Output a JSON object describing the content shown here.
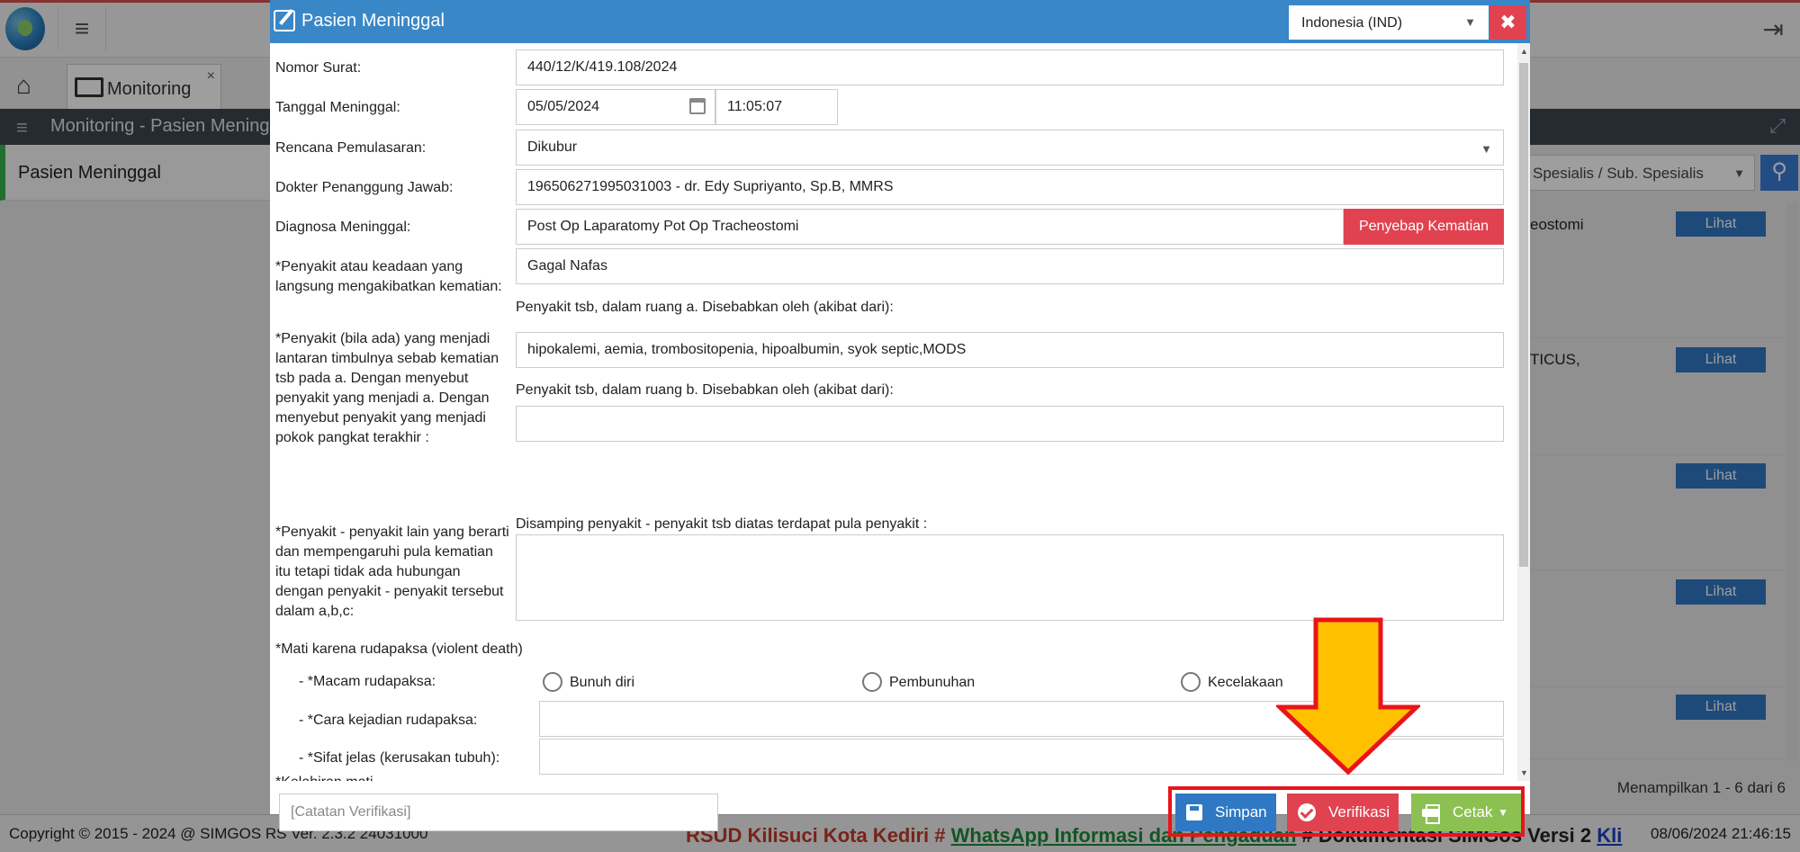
{
  "app": {
    "tab_label": "Monitoring",
    "tab_close": "×",
    "panel_title": "Monitoring - Pasien Meninggal",
    "sidebar_item": "Pasien Meninggal",
    "filter_placeholder": "Spesialis / Sub. Spesialis",
    "rows": [
      {
        "text": "eostomi",
        "action": "Lihat"
      },
      {
        "text": "TICUS,",
        "action": "Lihat"
      },
      {
        "text": "",
        "action": "Lihat"
      },
      {
        "text": "",
        "action": "Lihat"
      },
      {
        "text": "",
        "action": "Lihat"
      }
    ],
    "pagination": "Menampilkan 1 - 6 dari 6",
    "footer": {
      "copyright": "Copyright © 2015 - 2024 @ SIMGOS RS Ver. 2.3.2 24031000",
      "ticker_part1": "RSUD Kilisuci Kota Kediri # ",
      "ticker_part2": "WhatsApp Informasi dan Pengaduan",
      "ticker_part3": " # Dokumentasi SIMGos Versi 2 ",
      "ticker_part4": "Kli",
      "datetime": "08/06/2024 21:46:15"
    }
  },
  "modal": {
    "title": "Pasien Meninggal",
    "language": "Indonesia (IND)",
    "close": "✖",
    "labels": {
      "nomor_surat": "Nomor Surat:",
      "tanggal": "Tanggal Meninggal:",
      "rencana": "Rencana Pemulasaran:",
      "dokter": "Dokter Penanggung Jawab:",
      "diagnosa": "Diagnosa Meninggal:",
      "penyakit_langsung": "*Penyakit atau keadaan yang langsung mengakibatkan kematian:",
      "penyakit_lantaran": "*Penyakit (bila ada) yang menjadi lantaran timbulnya sebab kematian tsb pada a. Dengan menyebut penyakit yang menjadi a. Dengan menyebut penyakit yang menjadi pokok pangkat terakhir :",
      "penyakit_lain": "*Penyakit - penyakit lain yang berarti dan mempengaruhi pula kematian itu tetapi tidak ada hubungan dengan penyakit - penyakit tersebut dalam a,b,c:",
      "ruang_a": "Penyakit tsb, dalam ruang a. Disebabkan oleh (akibat dari):",
      "ruang_b": "Penyakit tsb, dalam ruang b. Disebabkan oleh (akibat dari):",
      "disamping": "Disamping penyakit - penyakit tsb diatas terdapat pula penyakit :",
      "rudapaksa": "*Mati karena rudapaksa (violent death)",
      "macam": "- *Macam rudapaksa:",
      "cara": "- *Cara kejadian rudapaksa:",
      "sifat": "- *Sifat jelas (kerusakan tubuh):",
      "kelahiran": "*Kelahiran mati"
    },
    "values": {
      "nomor_surat": "440/12/K/419.108/2024",
      "tanggal": "05/05/2024",
      "jam": "11:05:07",
      "rencana": "Dikubur",
      "dokter": "196506271995031003 - dr. Edy Supriyanto, Sp.B, MMRS",
      "diagnosa": "Post Op Laparatomy Pot Op Tracheostomi",
      "penyebab_button": "Penyebap Kematian",
      "penyakit_langsung": "Gagal Nafas",
      "ruang_a_value": "hipokalemi, aemia, trombositopenia, hipoalbumin, syok septic,MODS",
      "ruang_b_value": "",
      "disamping_value": "",
      "cara_value": "",
      "sifat_value": ""
    },
    "radios": [
      "Bunuh diri",
      "Pembunuhan",
      "Kecelakaan"
    ],
    "footer": {
      "catatan_placeholder": "[Catatan Verifikasi]",
      "simpan": "Simpan",
      "verifikasi": "Verifikasi",
      "cetak": "Cetak"
    }
  },
  "colors": {
    "header_blue": "#3a87c8",
    "danger_red": "#e0434f",
    "primary_blue": "#2f78c4",
    "success_green": "#8cc152",
    "annotation_red": "#e8141a",
    "arrow_yellow": "#ffc000"
  }
}
